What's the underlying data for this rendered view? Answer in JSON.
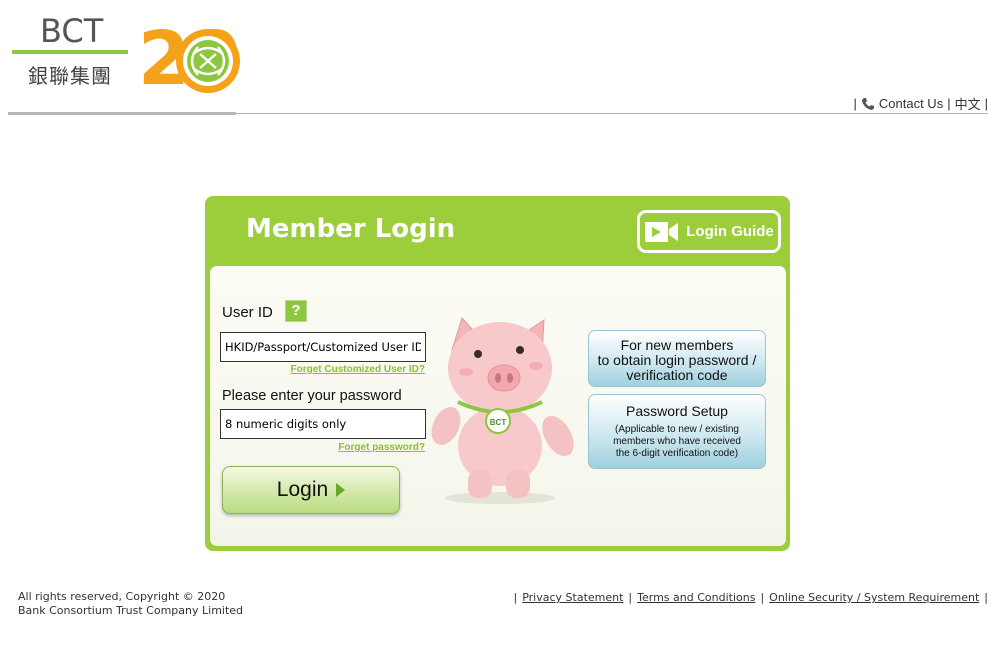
{
  "header": {
    "logo_text": "BCT",
    "logo_cn": "銀聯集團",
    "anniversary": "20",
    "contact_label": "Contact Us",
    "language_label": "中文"
  },
  "login": {
    "title": "Member Login",
    "guide_label": "Login Guide",
    "user_id_label": "User ID",
    "help_icon": "?",
    "user_id_placeholder": "HKID/Passport/Customized User ID",
    "forget_user_id": "Forget Customized User ID?",
    "password_label": "Please enter your password",
    "password_placeholder": "8 numeric digits only",
    "forget_password": "Forget password?",
    "login_button": "Login",
    "mascot_badge": "BCT",
    "new_members_button": "For new members to obtain login password / verification code",
    "new_members_lines": [
      "For new members",
      "to obtain login password /",
      "verification code"
    ],
    "password_setup_title": "Password Setup",
    "password_setup_sub_lines": [
      "(Applicable to new / existing",
      "members who have received",
      "the 6-digit verification code)"
    ]
  },
  "footer": {
    "copyright_line1": "All rights reserved, Copyright © 2020",
    "copyright_line2": "Bank Consortium Trust Company Limited",
    "links": [
      "Privacy Statement",
      "Terms and Conditions",
      "Online Security / System Requirement"
    ]
  },
  "colors": {
    "brand_green": "#9ccd3a",
    "brand_orange": "#f5a21b",
    "link_green": "#8cbf2e",
    "button_blue": "#9fd0de"
  },
  "icons": [
    "phone-icon",
    "video-camera-icon",
    "help-icon",
    "arrow-right-icon"
  ]
}
